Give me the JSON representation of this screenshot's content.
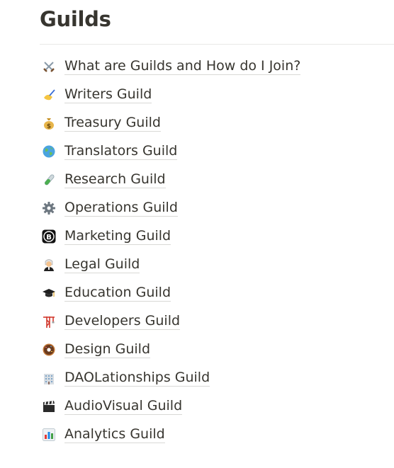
{
  "page": {
    "title": "Guilds"
  },
  "guilds": [
    {
      "label": "What are Guilds and How do I Join?",
      "icon": "crossed-swords-icon"
    },
    {
      "label": "Writers Guild",
      "icon": "writing-hand-icon"
    },
    {
      "label": "Treasury Guild",
      "icon": "money-bag-icon"
    },
    {
      "label": "Translators Guild",
      "icon": "globe-icon"
    },
    {
      "label": "Research Guild",
      "icon": "test-tube-icon"
    },
    {
      "label": "Operations Guild",
      "icon": "gear-icon"
    },
    {
      "label": "Marketing Guild",
      "icon": "bitcoin-logo-icon"
    },
    {
      "label": "Legal Guild",
      "icon": "judge-icon"
    },
    {
      "label": "Education Guild",
      "icon": "graduation-cap-icon"
    },
    {
      "label": "Developers Guild",
      "icon": "construction-crane-icon"
    },
    {
      "label": "Design Guild",
      "icon": "donut-icon"
    },
    {
      "label": "DAOLationships Guild",
      "icon": "office-building-icon"
    },
    {
      "label": "AudioVisual Guild",
      "icon": "clapper-board-icon"
    },
    {
      "label": "Analytics Guild",
      "icon": "bar-chart-icon"
    }
  ]
}
